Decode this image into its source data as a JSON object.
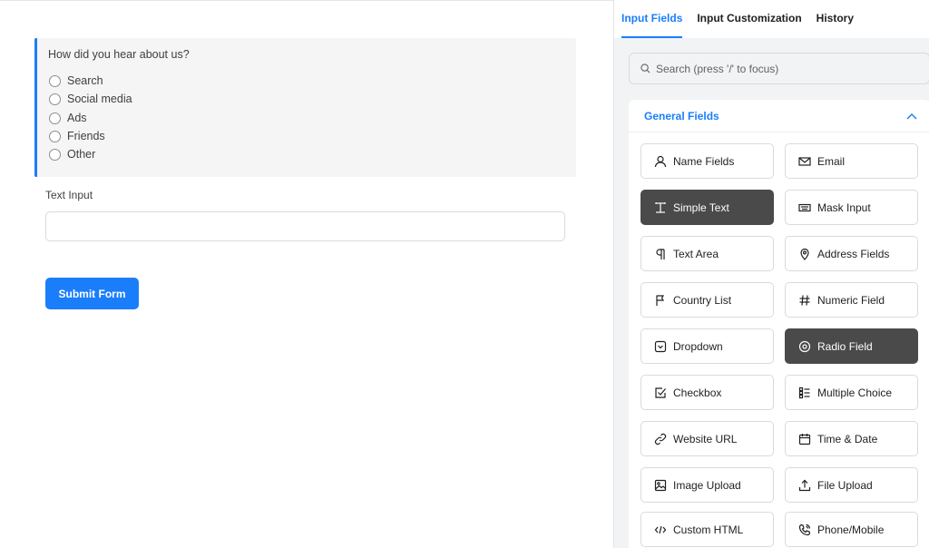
{
  "form": {
    "question": "How did you hear about us?",
    "options": [
      "Search",
      "Social media",
      "Ads",
      "Friends",
      "Other"
    ],
    "text_input_label": "Text Input",
    "text_input_value": "",
    "submit_label": "Submit Form"
  },
  "sidebar": {
    "tabs": [
      {
        "label": "Input Fields",
        "active": true
      },
      {
        "label": "Input Customization",
        "active": false
      },
      {
        "label": "History",
        "active": false
      }
    ],
    "search_placeholder": "Search (press '/' to focus)",
    "section_title": "General Fields",
    "fields": [
      {
        "label": "Name Fields",
        "icon": "person-icon"
      },
      {
        "label": "Email",
        "icon": "envelope-icon"
      },
      {
        "label": "Simple Text",
        "icon": "text-cursor-icon",
        "highlighted": true
      },
      {
        "label": "Mask Input",
        "icon": "keyboard-icon"
      },
      {
        "label": "Text Area",
        "icon": "paragraph-icon"
      },
      {
        "label": "Address Fields",
        "icon": "map-pin-icon"
      },
      {
        "label": "Country List",
        "icon": "flag-icon"
      },
      {
        "label": "Numeric Field",
        "icon": "hash-icon"
      },
      {
        "label": "Dropdown",
        "icon": "dropdown-icon"
      },
      {
        "label": "Radio Field",
        "icon": "radio-icon",
        "highlighted": true
      },
      {
        "label": "Checkbox",
        "icon": "checkbox-icon"
      },
      {
        "label": "Multiple Choice",
        "icon": "list-icon"
      },
      {
        "label": "Website URL",
        "icon": "link-icon"
      },
      {
        "label": "Time & Date",
        "icon": "calendar-icon"
      },
      {
        "label": "Image Upload",
        "icon": "image-icon"
      },
      {
        "label": "File Upload",
        "icon": "upload-icon"
      },
      {
        "label": "Custom HTML",
        "icon": "code-icon"
      },
      {
        "label": "Phone/Mobile",
        "icon": "phone-icon"
      }
    ]
  },
  "colors": {
    "accent": "#1a7efb",
    "highlight": "#4a4a4a",
    "question_bg": "#f5f5f5"
  }
}
